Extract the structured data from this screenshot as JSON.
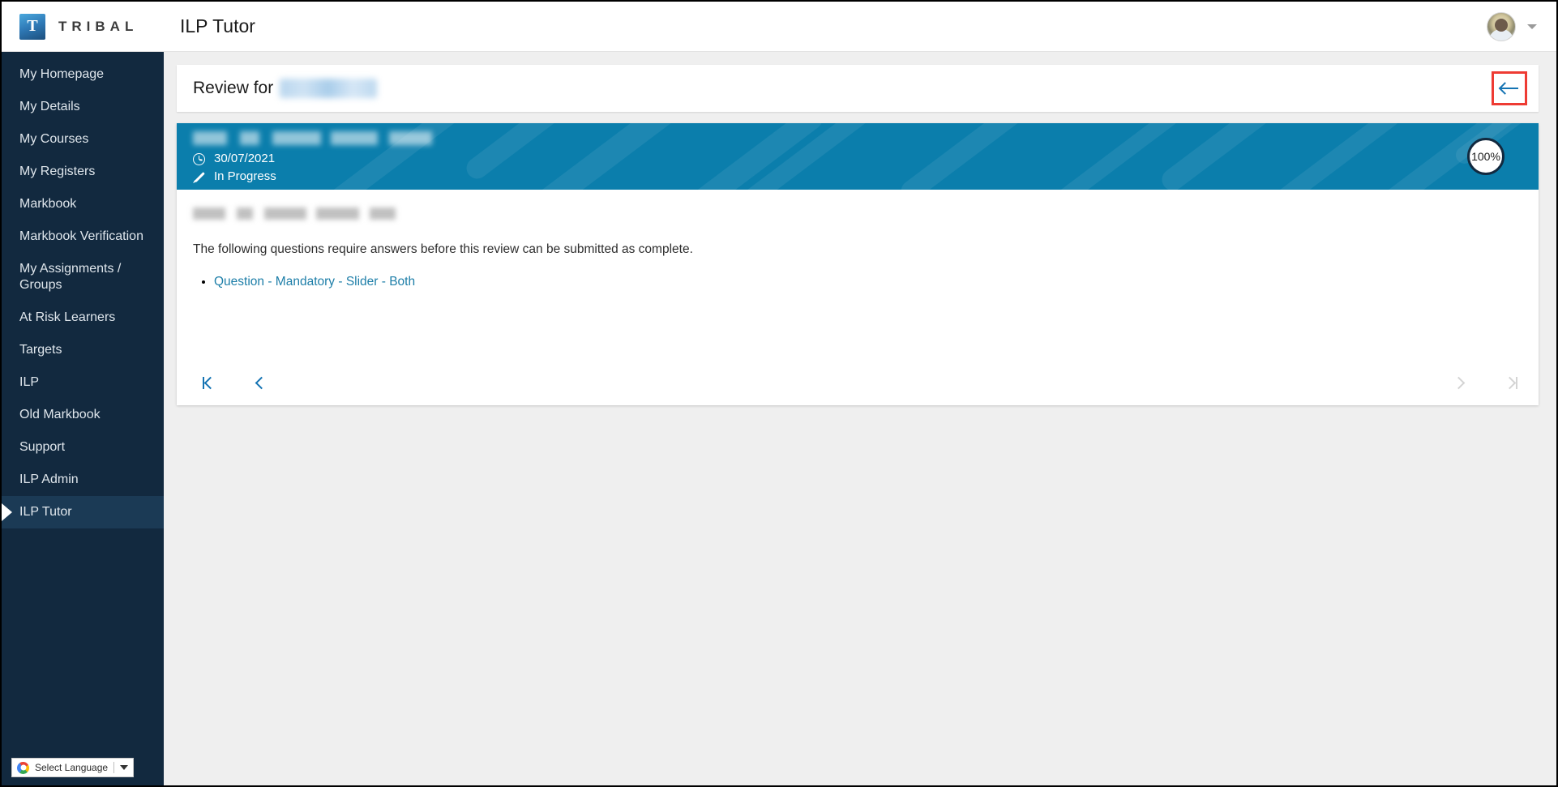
{
  "window": {
    "brand_letter": "T",
    "brand_name": "TRIBAL",
    "app_title": "ILP Tutor"
  },
  "sidebar": {
    "items": [
      {
        "label": "My Homepage",
        "active": false
      },
      {
        "label": "My Details",
        "active": false
      },
      {
        "label": "My Courses",
        "active": false
      },
      {
        "label": "My Registers",
        "active": false
      },
      {
        "label": "Markbook",
        "active": false
      },
      {
        "label": "Markbook Verification",
        "active": false
      },
      {
        "label": "My Assignments / Groups",
        "active": false
      },
      {
        "label": "At Risk Learners",
        "active": false
      },
      {
        "label": "Targets",
        "active": false
      },
      {
        "label": "ILP",
        "active": false
      },
      {
        "label": "Old Markbook",
        "active": false
      },
      {
        "label": "Support",
        "active": false
      },
      {
        "label": "ILP Admin",
        "active": false
      },
      {
        "label": "ILP Tutor",
        "active": true
      }
    ],
    "language_widget": {
      "label": "Select Language",
      "icon": "google-logo-icon",
      "caret": "chevron-down-icon"
    }
  },
  "page_header": {
    "title_prefix": "Review for",
    "subject_name_redacted": "[redacted]",
    "back_button": {
      "icon": "arrow-left-icon",
      "highlight_color": "#ee3b33"
    }
  },
  "review_banner": {
    "title_redacted": "[redacted]",
    "date": "30/07/2021",
    "date_icon": "clock-icon",
    "status": "In Progress",
    "status_icon": "pencil-icon",
    "progress_percent": "100%",
    "background_color": "#0b7eac"
  },
  "review_body": {
    "heading_redacted": "[redacted]",
    "message": "The following questions require answers before this review can be submitted as complete.",
    "questions": [
      {
        "label": "Question - Mandatory - Slider - Both"
      }
    ]
  },
  "pagination": {
    "first": {
      "icon": "first-page-icon",
      "enabled": true
    },
    "previous": {
      "icon": "previous-page-icon",
      "enabled": true
    },
    "next": {
      "icon": "next-page-icon",
      "enabled": false
    },
    "last": {
      "icon": "last-page-icon",
      "enabled": false
    }
  },
  "colors": {
    "sidebar": "#12293f",
    "sidebar_active": "#1b3a55",
    "banner_teal": "#0b7eac",
    "link_blue": "#1d7ea8",
    "accent_blue": "#1473b3",
    "highlight_red": "#ee3b33",
    "page_background": "#efefef"
  }
}
